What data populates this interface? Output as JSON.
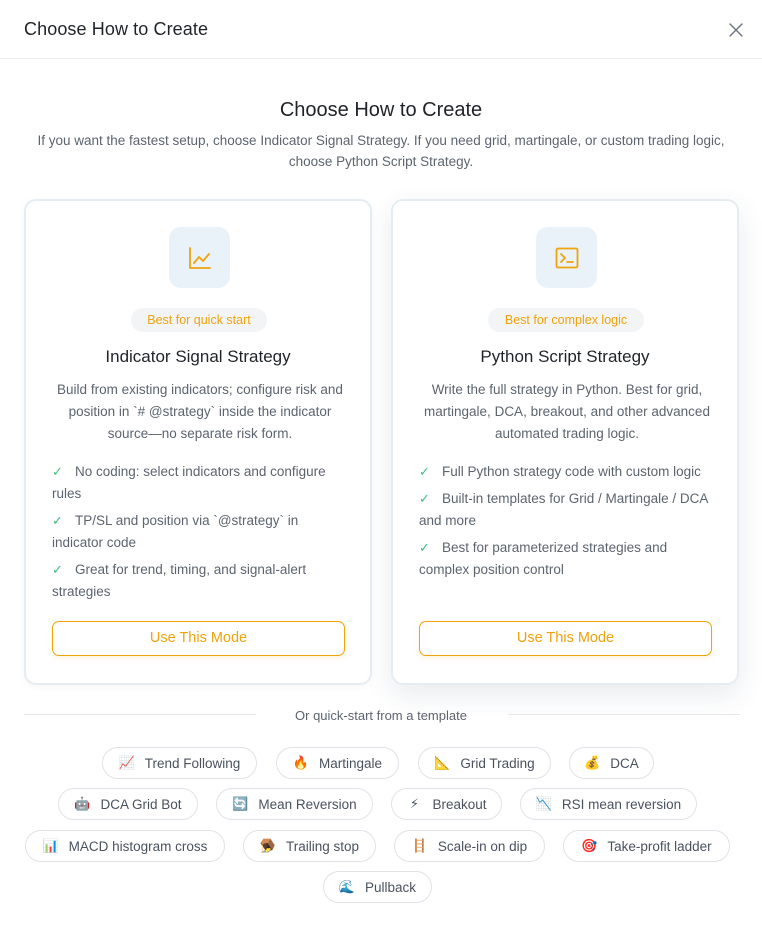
{
  "dialog": {
    "header_title": "Choose How to Create",
    "close_label": "X"
  },
  "intro": {
    "title": "Choose How to Create",
    "description": "If you want the fastest setup, choose Indicator Signal Strategy. If you need grid, martingale, or custom trading logic, choose Python Script Strategy."
  },
  "cards": [
    {
      "icon": "line-chart-icon",
      "badge": "Best for quick start",
      "title": "Indicator Signal Strategy",
      "description": "Build from existing indicators; configure risk and position in `# @strategy` inside the indicator source—no separate risk form.",
      "features": [
        "No coding: select indicators and configure rules",
        "TP/SL and position via `@strategy` in indicator code",
        "Great for trend, timing, and signal-alert strategies"
      ],
      "button_label": "Use This Mode"
    },
    {
      "icon": "terminal-icon",
      "badge": "Best for complex logic",
      "title": "Python Script Strategy",
      "description": "Write the full strategy in Python. Best for grid, martingale, DCA, breakout, and other advanced automated trading logic.",
      "features": [
        "Full Python strategy code with custom logic",
        "Built-in templates for Grid / Martingale / DCA and more",
        "Best for parameterized strategies and complex position control"
      ],
      "button_label": "Use This Mode"
    }
  ],
  "check_glyph": "✓",
  "templates": {
    "divider_label": "Or quick-start from a template",
    "items": [
      {
        "label": "Trend Following",
        "emoji": "📈"
      },
      {
        "label": "Martingale",
        "emoji": "🔥"
      },
      {
        "label": "Grid Trading",
        "emoji": "📐"
      },
      {
        "label": "DCA",
        "emoji": "💰"
      },
      {
        "label": "DCA Grid Bot",
        "emoji": "🤖"
      },
      {
        "label": "Mean Reversion",
        "emoji": "🔄"
      },
      {
        "label": "Breakout",
        "emoji": "⚡"
      },
      {
        "label": "RSI mean reversion",
        "emoji": "📉"
      },
      {
        "label": "MACD histogram cross",
        "emoji": "📊"
      },
      {
        "label": "Trailing stop",
        "emoji": "🪤"
      },
      {
        "label": "Scale-in on dip",
        "emoji": "🪜"
      },
      {
        "label": "Take-profit ladder",
        "emoji": "🎯"
      },
      {
        "label": "Pullback",
        "emoji": "🌊"
      }
    ]
  },
  "colors": {
    "accent": "#f0a30a",
    "check": "#3fbf7f",
    "icon_bg": "#e9f2f8"
  }
}
